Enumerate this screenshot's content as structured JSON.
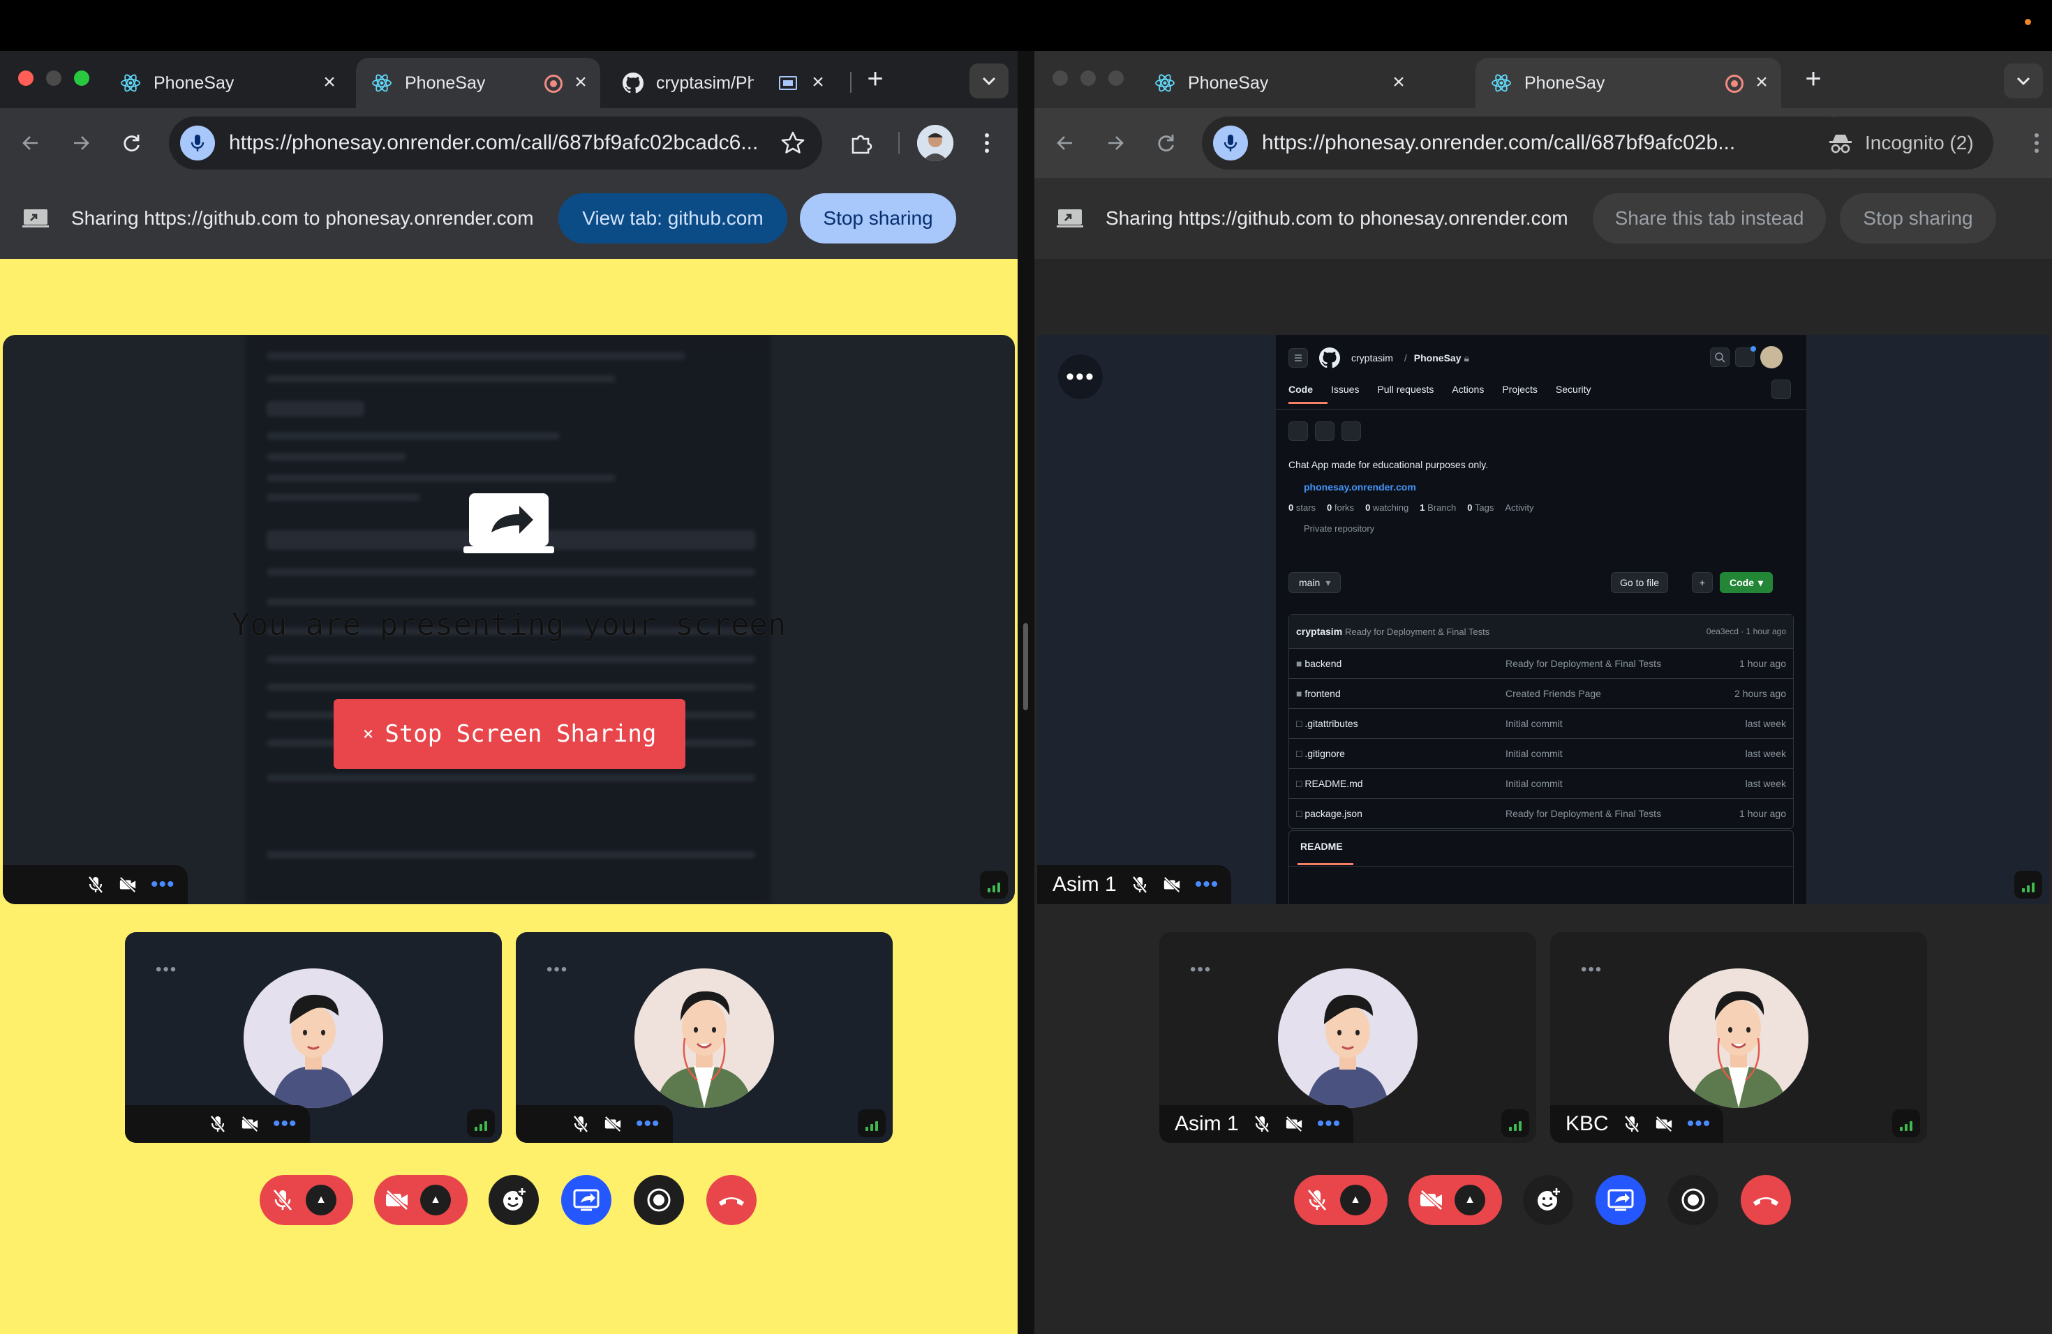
{
  "left_window": {
    "tabs": [
      {
        "label": "PhoneSay",
        "active": false,
        "recording": false
      },
      {
        "label": "PhoneSay",
        "active": true,
        "recording": true
      },
      {
        "label": "cryptasim/PhoneSay",
        "active": false,
        "recording": false
      }
    ],
    "url": "https://phonesay.onrender.com/call/687bf9afc02bcadc6...",
    "infobar": {
      "text": "Sharing https://github.com to phonesay.onrender.com",
      "view_tab_label": "View tab: github.com",
      "stop_label": "Stop sharing"
    },
    "presenting_text": "You are presenting your screen",
    "stop_screen_sharing_label": "Stop Screen Sharing",
    "stop_screen_sharing_icon": "×",
    "background_color": "#fef06a"
  },
  "right_window": {
    "tabs": [
      {
        "label": "PhoneSay",
        "active": false,
        "recording": false
      },
      {
        "label": "PhoneSay",
        "active": true,
        "recording": true
      }
    ],
    "url": "https://phonesay.onrender.com/call/687bf9afc02b...",
    "incognito_label": "Incognito (2)",
    "infobar": {
      "text": "Sharing https://github.com to phonesay.onrender.com",
      "share_instead_label": "Share this tab instead",
      "stop_label": "Stop sharing"
    },
    "main_name": "Asim 1",
    "participants": [
      {
        "name": "Asim 1"
      },
      {
        "name": "KBC"
      }
    ],
    "github": {
      "owner": "cryptasim",
      "separator": "/",
      "repo": "PhoneSay",
      "nav": [
        "Code",
        "Issues",
        "Pull requests",
        "Actions",
        "Projects",
        "Security"
      ],
      "description": "Chat App made for educational purposes only.",
      "link": "phonesay.onrender.com",
      "stats": [
        {
          "value": "0",
          "label": "stars"
        },
        {
          "value": "0",
          "label": "forks"
        },
        {
          "value": "0",
          "label": "watching"
        },
        {
          "value": "1",
          "label": "Branch"
        },
        {
          "value": "0",
          "label": "Tags"
        },
        {
          "value": "",
          "label": "Activity"
        }
      ],
      "private_label": "Private repository",
      "branch": "main",
      "go_to_file": "Go to file",
      "code_button": "Code",
      "commit": {
        "author": "cryptasim",
        "message": "Ready for Deployment & Final Tests",
        "meta": "0ea3ecd · 1 hour ago"
      },
      "files": [
        {
          "name": "backend",
          "type": "folder",
          "message": "Ready for Deployment & Final Tests",
          "time": "1 hour ago"
        },
        {
          "name": "frontend",
          "type": "folder",
          "message": "Created Friends Page",
          "time": "2 hours ago"
        },
        {
          "name": ".gitattributes",
          "type": "file",
          "message": "Initial commit",
          "time": "last week"
        },
        {
          "name": ".gitignore",
          "type": "file",
          "message": "Initial commit",
          "time": "last week"
        },
        {
          "name": "README.md",
          "type": "file",
          "message": "Initial commit",
          "time": "last week"
        },
        {
          "name": "package.json",
          "type": "file",
          "message": "Ready for Deployment & Final Tests",
          "time": "1 hour ago"
        }
      ],
      "readme_label": "README"
    }
  },
  "colors": {
    "danger": "#e8464b",
    "accent_blue": "#2557ff",
    "tile_bg": "#1a212b",
    "signal_green": "#3fb950"
  }
}
